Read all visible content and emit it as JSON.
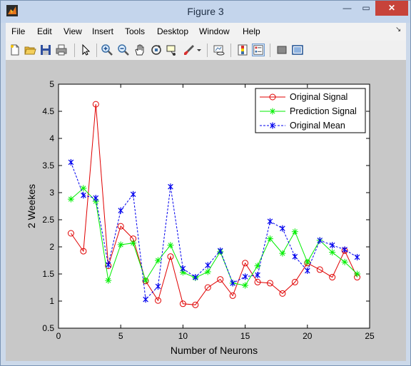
{
  "window": {
    "title": "Figure 3",
    "minimize_glyph": "—",
    "maximize_glyph": "▭",
    "close_glyph": "✕"
  },
  "menu": [
    "File",
    "Edit",
    "View",
    "Insert",
    "Tools",
    "Desktop",
    "Window",
    "Help"
  ],
  "dock_glyph": "↘",
  "toolbar_icons": [
    "new-figure-icon",
    "open-file-icon",
    "save-icon",
    "print-icon",
    "edit-plot-arrow-icon",
    "zoom-in-icon",
    "zoom-out-icon",
    "pan-hand-icon",
    "rotate-3d-icon",
    "data-cursor-icon",
    "brush-icon",
    "brush-dropdown-icon",
    "link-plot-icon",
    "insert-colorbar-icon",
    "insert-legend-icon",
    "hide-plot-tools-icon",
    "show-plot-tools-icon"
  ],
  "colors": {
    "original": "#e00000",
    "prediction": "#00ee00",
    "mean": "#0000ee",
    "close_button": "#c7433a"
  },
  "chart_data": {
    "type": "line",
    "xlabel": "Number of Neurons",
    "ylabel": "2 Weekes",
    "xlim": [
      0,
      25
    ],
    "ylim": [
      0.5,
      5
    ],
    "xticks": [
      "0",
      "5",
      "10",
      "15",
      "20",
      "25"
    ],
    "yticks": [
      "0.5",
      "1",
      "1.5",
      "2",
      "2.5",
      "3",
      "3.5",
      "4",
      "4.5",
      "5"
    ],
    "grid": false,
    "legend_position": "top-right",
    "x": [
      1,
      2,
      3,
      4,
      5,
      6,
      7,
      8,
      9,
      10,
      11,
      12,
      13,
      14,
      15,
      16,
      17,
      18,
      19,
      20,
      21,
      22,
      23,
      24
    ],
    "series": [
      {
        "name": "Original Signal",
        "style": "solid",
        "marker": "circle",
        "values": [
          2.25,
          1.92,
          4.63,
          1.65,
          2.38,
          2.15,
          1.37,
          1.01,
          1.82,
          0.95,
          0.93,
          1.25,
          1.4,
          1.1,
          1.7,
          1.35,
          1.33,
          1.14,
          1.35,
          1.7,
          1.58,
          1.44,
          1.93,
          1.44
        ]
      },
      {
        "name": "Prediction Signal",
        "style": "solid",
        "marker": "star",
        "values": [
          2.88,
          3.08,
          2.84,
          1.38,
          2.04,
          2.07,
          1.38,
          1.75,
          2.03,
          1.53,
          1.43,
          1.54,
          1.91,
          1.33,
          1.29,
          1.65,
          2.15,
          1.88,
          2.28,
          1.72,
          2.12,
          1.9,
          1.72,
          1.5
        ]
      },
      {
        "name": "Original Mean",
        "style": "dashed",
        "marker": "asterisk",
        "values": [
          3.56,
          2.95,
          2.9,
          1.67,
          2.67,
          2.97,
          1.03,
          1.27,
          3.11,
          1.6,
          1.44,
          1.66,
          1.93,
          1.33,
          1.45,
          1.48,
          2.47,
          2.34,
          1.82,
          1.56,
          2.12,
          2.03,
          1.95,
          1.81
        ]
      }
    ]
  }
}
